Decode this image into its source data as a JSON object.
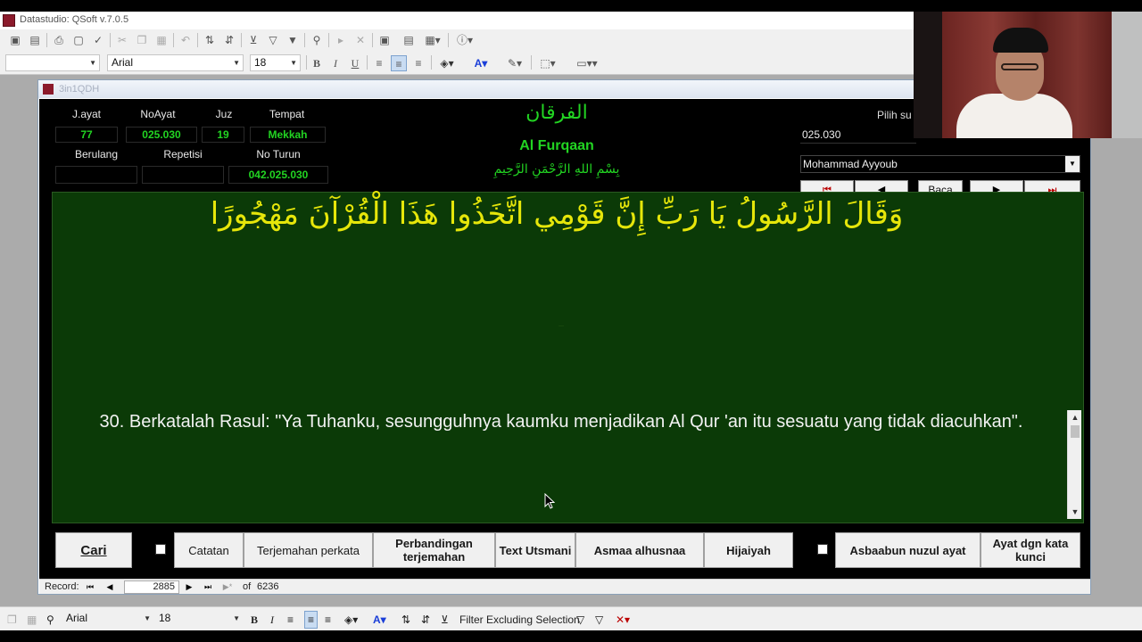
{
  "window": {
    "title": "Datastudio: QSoft v.7.0.5"
  },
  "toolbar2": {
    "font_name": "Arial",
    "font_size": "18"
  },
  "form": {
    "title": "3in1QDH",
    "labels": {
      "jayat": "J.ayat",
      "noayat": "NoAyat",
      "juz": "Juz",
      "tempat": "Tempat",
      "berulang": "Berulang",
      "repetisi": "Repetisi",
      "noturun": "No Turun"
    },
    "values": {
      "jayat": "77",
      "noayat": "025.030",
      "juz": "19",
      "tempat": "Mekkah",
      "berulang": "",
      "repetisi": "",
      "noturun": "042.025.030"
    },
    "surah_arabic": "الفرقان",
    "surah_latin": "Al Furqaan",
    "basmala": "بِسْمِ اللهِ الرَّحْمَنِ الرَّحِيمِ",
    "pilih_label": "Pilih su",
    "ayat_ref": "025.030",
    "reciter": "Mohammad Ayyoub",
    "nav": {
      "first": "⏮",
      "prev": "◀",
      "read": "Baca",
      "next": "▶",
      "last": "⏭"
    },
    "verse_arabic": "وَقَالَ الرَّسُولُ يَا رَبِّ إِنَّ قَوْمِي اتَّخَذُوا هَذَا الْقُرْآنَ مَهْجُورًا",
    "translation": "30. Berkatalah Rasul: \"Ya Tuhanku, sesungguhnya kaumku menjadikan Al Qur 'an itu sesuatu yang tidak diacuhkan\".",
    "buttons": {
      "cari": "Cari",
      "catatan": "Catatan",
      "terjemahan_perkata": "Terjemahan perkata",
      "perbandingan": "Perbandingan terjemahan",
      "text_utsmani": "Text Utsmani",
      "asmaa": "Asmaa alhusnaa",
      "hijaiyah": "Hijaiyah",
      "asbaabun": "Asbaabun nuzul ayat",
      "ayat_kunci": "Ayat dgn kata kunci"
    }
  },
  "record": {
    "label": "Record:",
    "current": "2885",
    "of_label": "of",
    "total": "6236"
  },
  "bottombar": {
    "font_name": "Arial",
    "font_size": "18",
    "filter_label": "Filter Excluding Selection"
  }
}
